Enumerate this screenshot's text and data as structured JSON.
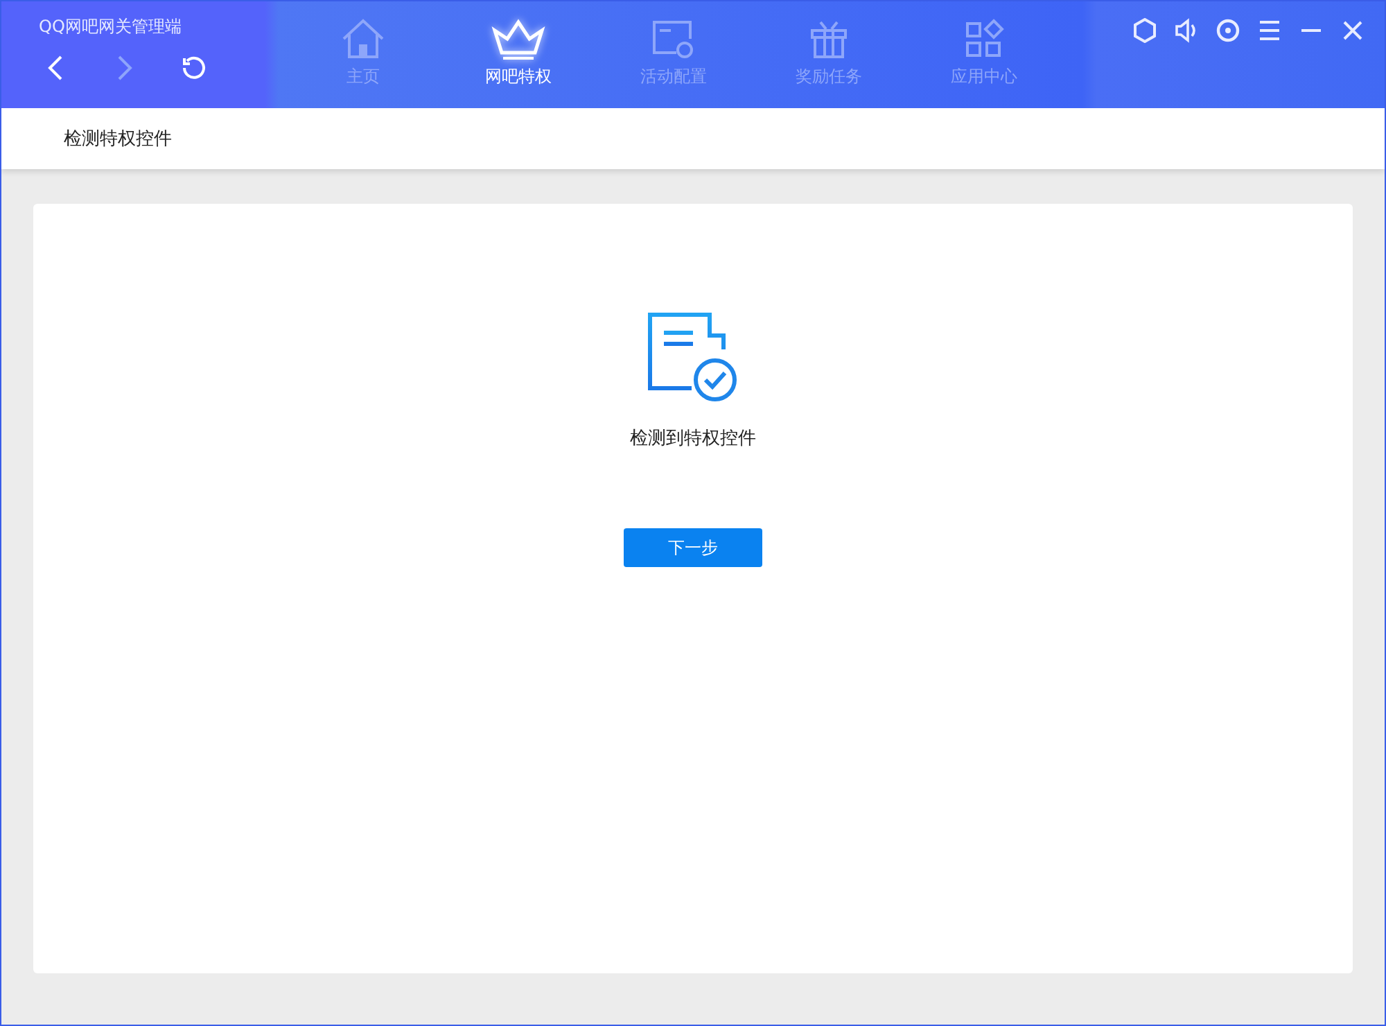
{
  "window": {
    "title": "QQ网吧网关管理端"
  },
  "nav_buttons": [
    {
      "kind": "back",
      "disabled": false
    },
    {
      "kind": "forward",
      "disabled": true
    },
    {
      "kind": "refresh",
      "disabled": false
    }
  ],
  "tabs": [
    {
      "kind": "home",
      "label": "主页",
      "selected": false
    },
    {
      "kind": "crown",
      "label": "网吧特权",
      "selected": true
    },
    {
      "kind": "activity",
      "label": "活动配置",
      "selected": false
    },
    {
      "kind": "gift",
      "label": "奖励任务",
      "selected": false
    },
    {
      "kind": "apps",
      "label": "应用中心",
      "selected": false
    }
  ],
  "breadcrumb": "检测特权控件",
  "result": {
    "message": "检测到特权控件",
    "button": "下一步"
  }
}
